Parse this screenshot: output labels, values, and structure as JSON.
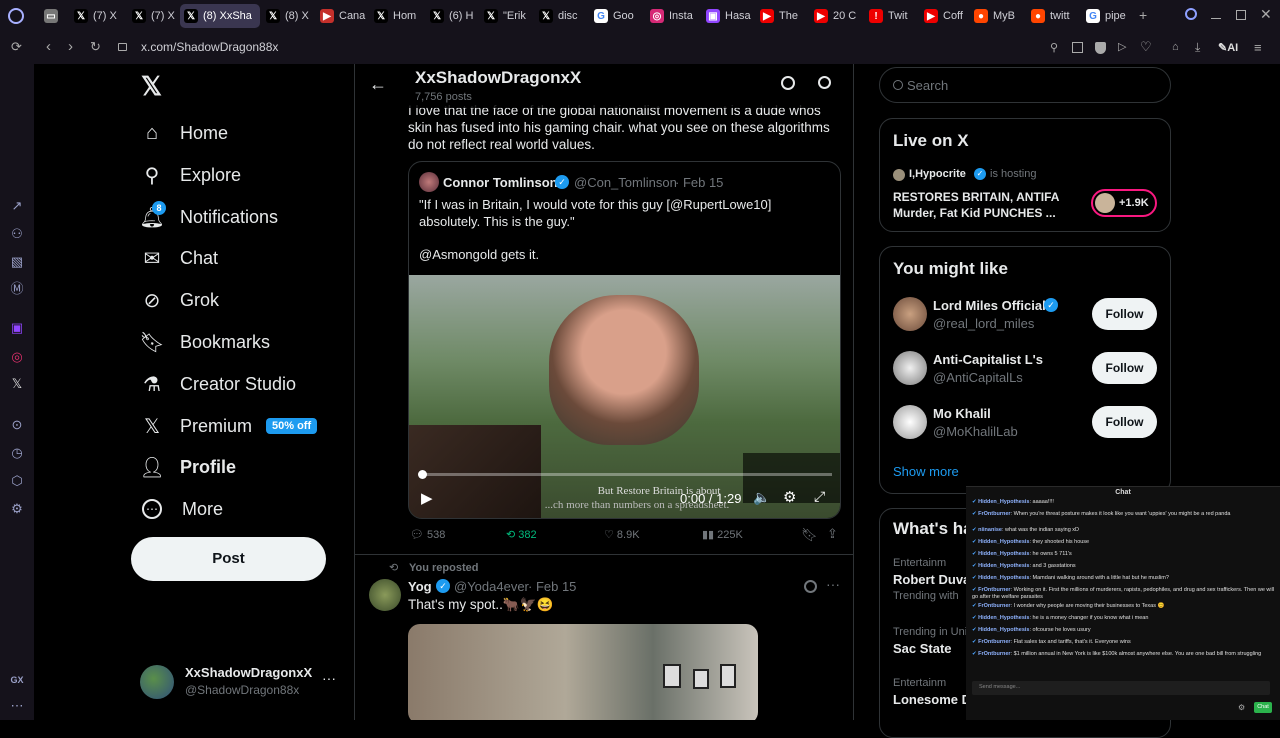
{
  "browser": {
    "tabs": [
      {
        "label": "",
        "icon": "screen-icon",
        "active": false
      },
      {
        "label": "(7) X",
        "icon": "x-icon",
        "active": false
      },
      {
        "label": "(7) X",
        "icon": "x-icon",
        "active": false
      },
      {
        "label": "(8) XxSha",
        "icon": "x-icon",
        "active": true
      },
      {
        "label": "(8) X",
        "icon": "x-icon",
        "active": false
      },
      {
        "label": "Cana",
        "icon": "play-icon",
        "active": false
      },
      {
        "label": "Hom",
        "icon": "x-icon",
        "active": false
      },
      {
        "label": "(6) H",
        "icon": "x-icon",
        "active": false
      },
      {
        "label": "\"Erik",
        "icon": "x-icon",
        "active": false
      },
      {
        "label": "disc",
        "icon": "x-icon",
        "active": false
      },
      {
        "label": "Goo",
        "icon": "google-icon",
        "active": false
      },
      {
        "label": "Insta",
        "icon": "instagram-icon",
        "active": false
      },
      {
        "label": "Hasa",
        "icon": "twitch-icon",
        "active": false
      },
      {
        "label": "The",
        "icon": "youtube-icon",
        "active": false
      },
      {
        "label": "20 C",
        "icon": "youtube-icon",
        "active": false
      },
      {
        "label": "Twit",
        "icon": "alert-icon",
        "active": false
      },
      {
        "label": "Coff",
        "icon": "youtube-icon",
        "active": false
      },
      {
        "label": "MyB",
        "icon": "reddit-icon",
        "active": false
      },
      {
        "label": "twitt",
        "icon": "reddit-icon",
        "active": false
      },
      {
        "label": "pipe",
        "icon": "google-icon",
        "active": false
      }
    ],
    "url": "x.com/ShadowDragon88x",
    "ai_label": "AI",
    "gx_label": "GX"
  },
  "nav": {
    "logo": "x-logo-icon",
    "items": [
      {
        "label": "Home",
        "icon": "home-icon"
      },
      {
        "label": "Explore",
        "icon": "search-icon"
      },
      {
        "label": "Notifications",
        "icon": "bell-icon",
        "badge": "8"
      },
      {
        "label": "Chat",
        "icon": "mail-icon"
      },
      {
        "label": "Grok",
        "icon": "grok-icon"
      },
      {
        "label": "Bookmarks",
        "icon": "bookmark-icon"
      },
      {
        "label": "Creator Studio",
        "icon": "flask-icon"
      },
      {
        "label": "Premium",
        "icon": "x-premium-icon",
        "promo": "50% off"
      },
      {
        "label": "Profile",
        "icon": "person-icon"
      },
      {
        "label": "More",
        "icon": "more-circle-icon"
      }
    ],
    "post_label": "Post",
    "account": {
      "name": "XxShadowDragonxX",
      "handle": "@ShadowDragon88x",
      "more": "···"
    }
  },
  "header": {
    "name": "XxShadowDragonxX",
    "posts": "7,756 posts"
  },
  "post1": {
    "text": "I love that the face of the global nationalist movement is a dude whos skin has fused into his gaming chair. what you see on these algorithms do not reflect real world values.",
    "quote": {
      "name": "Connor Tomlinson",
      "handle": "@Con_Tomlinson",
      "date": "· Feb 15",
      "text1": "\"If I was in Britain, I would vote for this guy [@RupertLowe10] absolutely. This is the guy.\"",
      "text2": "@Asmongold gets it.",
      "video": {
        "caption": "But Restore Britain is about",
        "caption2": "...ch more than numbers on a spreadsheet.",
        "time": "0:00 / 1:29",
        "progress": 0.0
      }
    },
    "stats": {
      "replies": "538",
      "reposts": "382",
      "likes": "8.9K",
      "views": "225K"
    }
  },
  "post2": {
    "reposted_label": "You reposted",
    "name": "Yog",
    "handle": "@Yoda4ever",
    "date": "· Feb 15",
    "text": "That's my spot..🐂🦅😆"
  },
  "right": {
    "search_placeholder": "Search",
    "live": {
      "title": "Live on X",
      "host": "I,Hypocrite",
      "hosting": "is hosting",
      "topic": "RESTORES BRITAIN, ANTIFA Murder, Fat Kid PUNCHES ...",
      "count": "+1.9K"
    },
    "wtf": {
      "title": "You might like",
      "users": [
        {
          "name": "Lord Miles Official",
          "handle": "@real_lord_miles",
          "verified": true
        },
        {
          "name": "Anti-Capitalist L's",
          "handle": "@AntiCapitalLs",
          "verified": false
        },
        {
          "name": "Mo Khalil",
          "handle": "@MoKhalilLab",
          "verified": false
        }
      ],
      "follow_label": "Follow",
      "show_more": "Show more"
    },
    "trends": {
      "title": "What's ha",
      "items": [
        {
          "context": "Entertainm",
          "name": "Robert Duva",
          "meta": "Trending with"
        },
        {
          "context": "Trending in Uni",
          "name": "Sac State",
          "meta": ""
        },
        {
          "context": "Entertainm",
          "name": "Lonesome D",
          "meta": ""
        }
      ]
    }
  },
  "chat": {
    "title": "Chat",
    "messages": [
      {
        "user": "Hidden_Hypothesis",
        "text": "aaaaa!!!!"
      },
      {
        "user": "FrOntburner",
        "text": "When you're threat posture makes it look like you want 'uppies' you might be a red panda"
      },
      {
        "user": "niinanise",
        "text": "what was the indian saying xD"
      },
      {
        "user": "Hidden_Hypothesis",
        "text": "they shooted his house"
      },
      {
        "user": "Hidden_Hypothesis",
        "text": "he owns 5 711's"
      },
      {
        "user": "Hidden_Hypothesis",
        "text": "and 3 gasstations"
      },
      {
        "user": "Hidden_Hypothesis",
        "text": "Mamdani walking around with a little hat but he muslim?"
      },
      {
        "user": "FrOntburner",
        "text": "Working on it. First the millions of murderers, rapists, pedophiles, and drug and sex traffickers. Then we will go after the welfare parasites"
      },
      {
        "user": "FrOntburner",
        "text": "I wonder why people are moving their businesses to Texas 😊"
      },
      {
        "user": "Hidden_Hypothesis",
        "text": "he is a money changer if you know what i mean"
      },
      {
        "user": "Hidden_Hypothesis",
        "text": "ofcourse he loves usury"
      },
      {
        "user": "FrOntburner",
        "text": "Flat sales tax and tariffs, that's it. Everyone wins"
      },
      {
        "user": "FrOntburner",
        "text": "$1 million annual in New York is like $100k almost anywhere else. You are one bad bill from struggling"
      }
    ],
    "input_placeholder": "Send message...",
    "send_label": "Chat"
  }
}
